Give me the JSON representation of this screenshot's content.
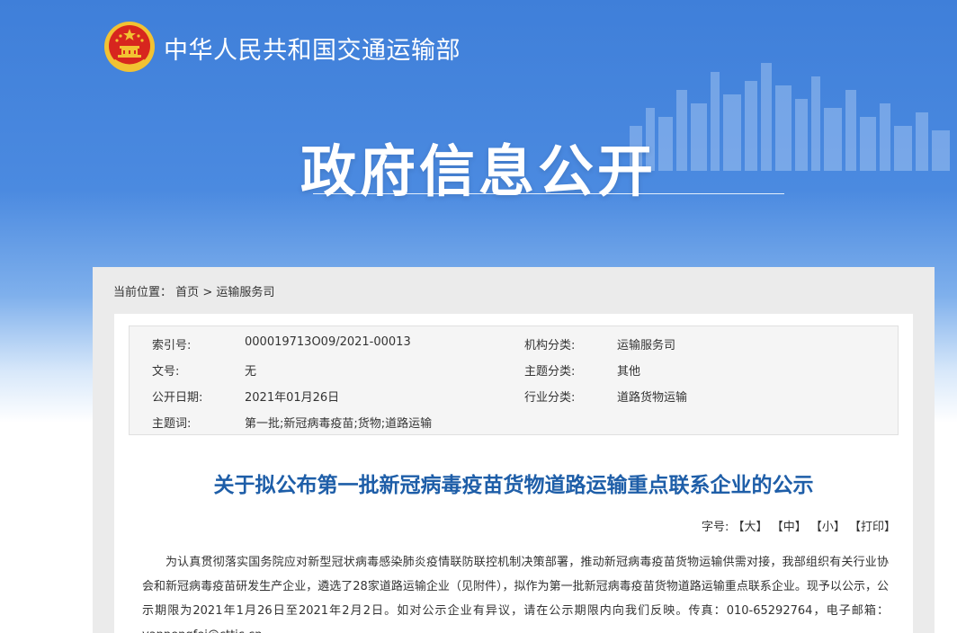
{
  "header": {
    "ministry_name": "中华人民共和国交通运输部",
    "section_title": "政府信息公开",
    "emblem_icon": "national-emblem-icon"
  },
  "breadcrumb": {
    "label": "当前位置：",
    "home": "首页",
    "separator": ">",
    "current": "运输服务司"
  },
  "meta": {
    "index_label": "索引号:",
    "index_value": "000019713O09/2021-00013",
    "org_label": "机构分类:",
    "org_value": "运输服务司",
    "docno_label": "文号:",
    "docno_value": "无",
    "topic_label": "主题分类:",
    "topic_value": "其他",
    "date_label": "公开日期:",
    "date_value": "2021年01月26日",
    "industry_label": "行业分类:",
    "industry_value": "道路货物运输",
    "keywords_label": "主题词:",
    "keywords_value": "第一批;新冠病毒疫苗;货物;道路运输"
  },
  "article": {
    "title": "关于拟公布第一批新冠病毒疫苗货物道路运输重点联系企业的公示",
    "fontsize_label": "字号:",
    "size_large": "【大】",
    "size_medium": "【中】",
    "size_small": "【小】",
    "print": "【打印】",
    "paragraph": "为认真贯彻落实国务院应对新型冠状病毒感染肺炎疫情联防联控机制决策部署，推动新冠病毒疫苗货物运输供需对接，我部组织有关行业协会和新冠病毒疫苗研发生产企业，遴选了28家道路运输企业（见附件），拟作为第一批新冠病毒疫苗货物道路运输重点联系企业。现予以公示，公示期限为2021年1月26日至2021年2月2日。如对公示企业有异议，请在公示期限内向我们反映。传真：010-65292764，电子邮箱：yanpengfei@cttic.cn。"
  },
  "colors": {
    "banner_top": "#3f7fd9",
    "title_blue": "#1e5ea8",
    "emblem_red": "#d7261e",
    "emblem_gold": "#f2c232"
  }
}
